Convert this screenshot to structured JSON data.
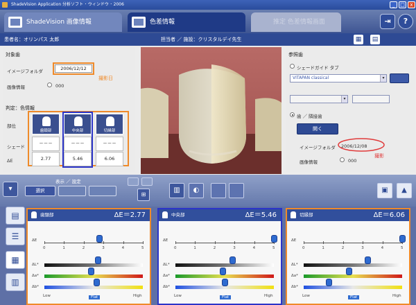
{
  "window": {
    "title": "ShadeVision Application 分析ソフト ･ ウィンドウ ･ 2006",
    "minimize": "_",
    "maximize": "□",
    "close": "x"
  },
  "tabs": [
    {
      "label": "ShadeVision 画像情報"
    },
    {
      "label": "色差情報"
    },
    {
      "label": "推定 色差情報画面"
    }
  ],
  "toolbar": {
    "exit_icon": "exit-icon",
    "help_label": "?"
  },
  "infobar": {
    "patient": "患者名：オリンパス 太郎",
    "doctor": "担当者 ／ 施設：クリスタルデイ先生",
    "icons": [
      "grid-icon",
      "calendar-icon"
    ]
  },
  "left_panel": {
    "section_title": "対象歯",
    "image_folder_label": "イメージフォルダ",
    "image_folder_value": "2006/12/12",
    "note": "撮影日",
    "image_info_label": "画像情報",
    "image_info_icon": "info-icon",
    "image_info_value": "000",
    "measure_title": "判定：色情報",
    "row_labels": [
      "部位",
      "シェード",
      "ΔE"
    ],
    "zones": [
      {
        "name": "歯頸部",
        "shade": "－－－",
        "de": "2.77"
      },
      {
        "name": "中央部",
        "shade": "－－－",
        "de": "5.46"
      },
      {
        "name": "切縁部",
        "shade": "－－－",
        "de": "6.06"
      }
    ]
  },
  "right_panel": {
    "title": "参照歯",
    "radio1_label": "シェードガイド タブ",
    "guide_select": "VITAPAN classical",
    "radio2_label": "歯 ／ 隣接歯",
    "open_button": "開く",
    "image_folder_label": "イメージフォルダ",
    "image_folder_value": "2006/12/08",
    "note": "撮影",
    "image_info_label": "画像情報",
    "image_info_value": "000"
  },
  "midbar": {
    "group_label": "表示 ／ 設定",
    "buttons": [
      "選択",
      "",
      ""
    ],
    "right_icons": [
      "photo-icon",
      "tooth-icon"
    ]
  },
  "zone_panels": [
    {
      "name": "歯頸部",
      "de_label": "ΔE＝2.77",
      "de": 2.77,
      "marks": {
        "dE": 2.77,
        "dL": 0.4,
        "da": -0.3,
        "db": 0.3
      }
    },
    {
      "name": "中央部",
      "de_label": "ΔE＝5.46",
      "de": 5.46,
      "marks": {
        "dE": 5.46,
        "dL": 0.8,
        "da": -0.2,
        "db": 0.0
      }
    },
    {
      "name": "切縁部",
      "de_label": "ΔE＝6.06",
      "de": 6.06,
      "marks": {
        "dE": 6.06,
        "dL": 1.5,
        "da": -0.4,
        "db": -2.5
      }
    }
  ],
  "scale": {
    "de_ticks": [
      "0",
      "1",
      "2",
      "3",
      "4",
      "5"
    ],
    "row_labels": [
      "ΔE",
      "ΔL*",
      "Δa*",
      "Δb*"
    ],
    "low": "Low",
    "high": "High",
    "flat": "Flat"
  },
  "colors": {
    "orange": "#ef8a2a",
    "blue": "#2b34c8",
    "navy": "#2e4a94"
  }
}
